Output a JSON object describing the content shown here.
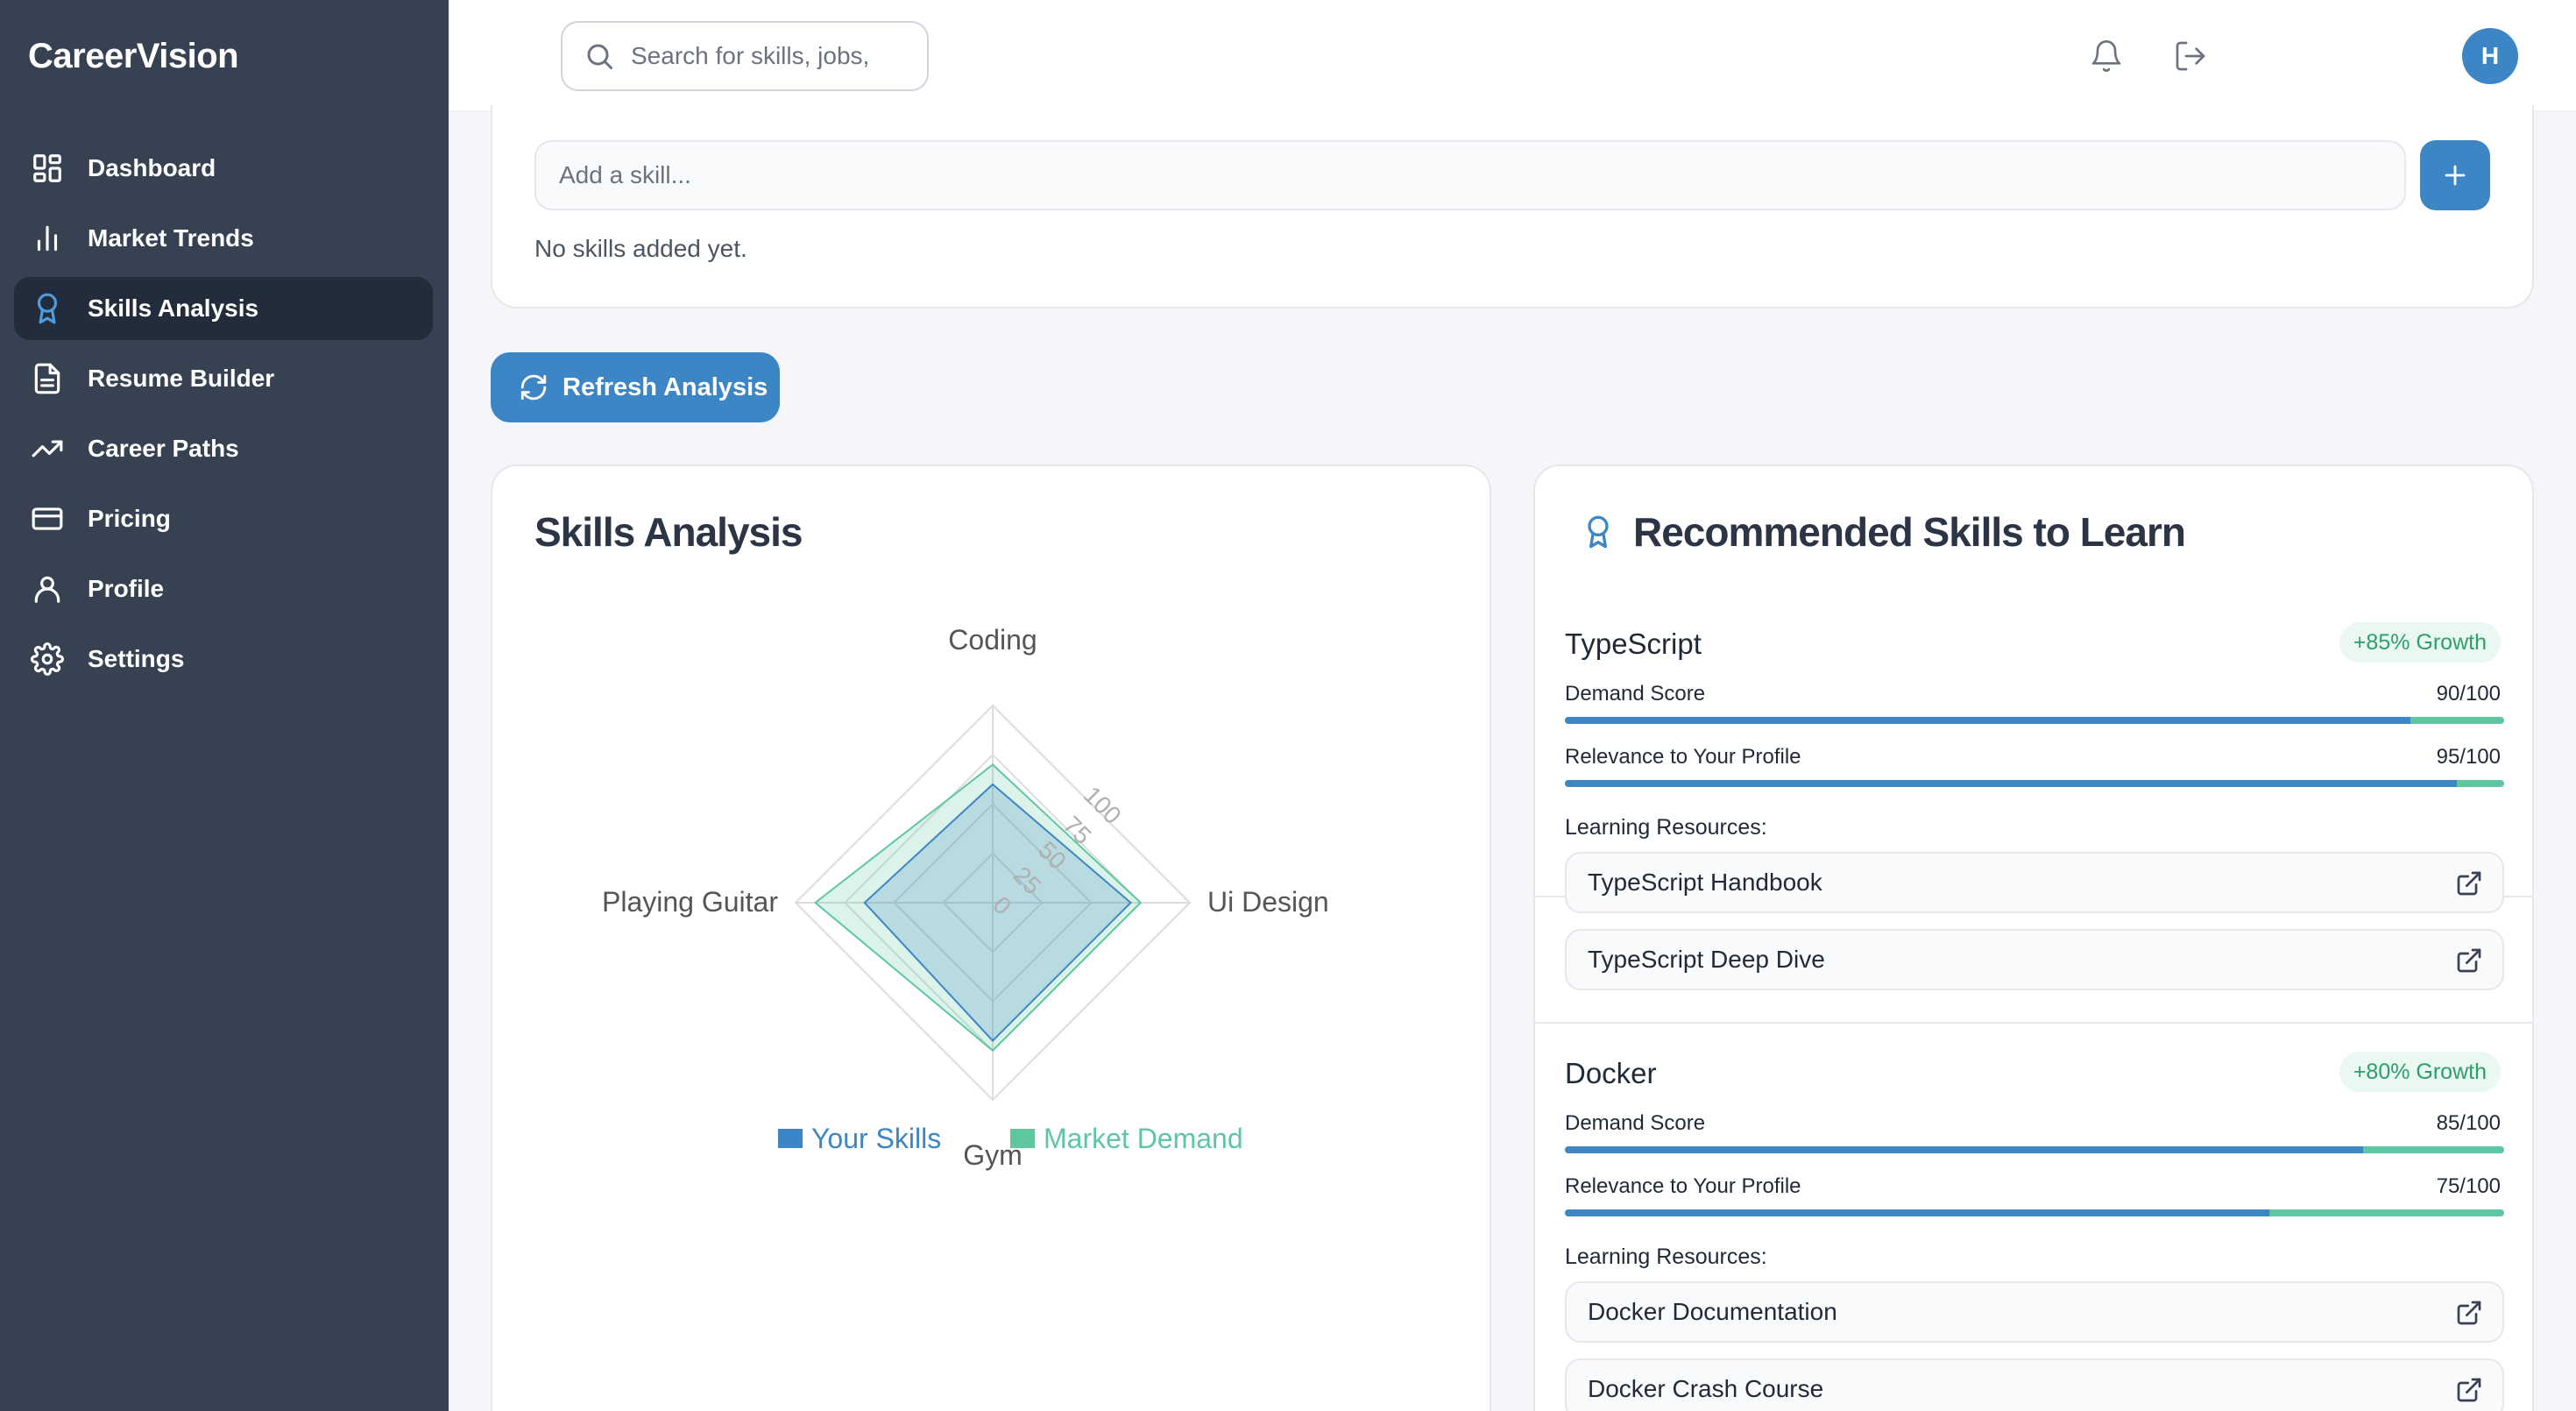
{
  "app": {
    "brand": "CareerVision"
  },
  "sidebar": {
    "items": [
      {
        "label": "Dashboard",
        "icon": "dashboard-icon"
      },
      {
        "label": "Market Trends",
        "icon": "bar-chart-icon"
      },
      {
        "label": "Skills Analysis",
        "icon": "award-icon",
        "active": true
      },
      {
        "label": "Resume Builder",
        "icon": "document-icon"
      },
      {
        "label": "Career Paths",
        "icon": "trending-up-icon"
      },
      {
        "label": "Pricing",
        "icon": "credit-card-icon"
      },
      {
        "label": "Profile",
        "icon": "user-icon"
      },
      {
        "label": "Settings",
        "icon": "gear-icon"
      }
    ]
  },
  "header": {
    "search_placeholder": "Search for skills, jobs,",
    "avatar_initial": "H"
  },
  "skills_input": {
    "placeholder": "Add a skill...",
    "empty_text": "No skills added yet."
  },
  "actions": {
    "refresh_label": "Refresh Analysis"
  },
  "analysis": {
    "title": "Skills Analysis",
    "chart_data": {
      "type": "radar",
      "axes": [
        "Coding",
        "Ui Design",
        "Gym",
        "Playing Guitar"
      ],
      "ticks": [
        0,
        25,
        50,
        75,
        100
      ],
      "rmax": 100,
      "series": [
        {
          "name": "Your Skills",
          "values": [
            60,
            70,
            70,
            65
          ],
          "color": "#3d86c6"
        },
        {
          "name": "Market Demand",
          "values": [
            70,
            75,
            75,
            90
          ],
          "color": "#5ec7a0"
        }
      ]
    }
  },
  "recommended": {
    "title": "Recommended Skills to Learn",
    "labels": {
      "demand": "Demand Score",
      "relevance": "Relevance to Your Profile",
      "resources": "Learning Resources:"
    },
    "skills": [
      {
        "name": "TypeScript",
        "growth": "+85% Growth",
        "demand_text": "90/100",
        "demand": 90,
        "relevance_text": "95/100",
        "relevance": 95,
        "resources": [
          "TypeScript Handbook",
          "TypeScript Deep Dive"
        ]
      },
      {
        "name": "Docker",
        "growth": "+80% Growth",
        "demand_text": "85/100",
        "demand": 85,
        "relevance_text": "75/100",
        "relevance": 75,
        "resources": [
          "Docker Documentation",
          "Docker Crash Course"
        ]
      }
    ]
  }
}
